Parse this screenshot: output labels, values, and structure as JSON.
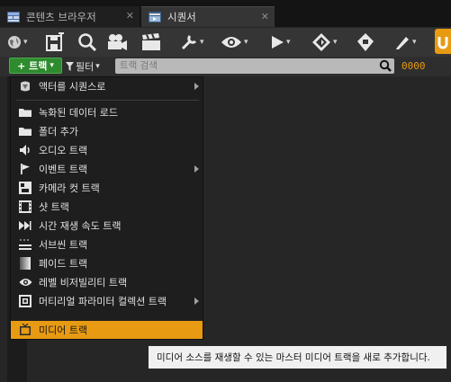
{
  "tabs": [
    {
      "label": "콘텐츠 브라우저",
      "close": "✕"
    },
    {
      "label": "시퀀서",
      "close": "✕"
    }
  ],
  "toolbar": {
    "dropdown_glyph": "▾"
  },
  "filter_bar": {
    "track_button": "+ 트랙",
    "track_dropdown": "▾",
    "filter_button": "필터",
    "filter_dropdown": "▾",
    "search_placeholder": "트랙 검색",
    "timecode": "0000"
  },
  "menu": {
    "items": [
      {
        "label": "액터를 시퀀스로",
        "icon": "actor-icon",
        "submenu": true
      },
      {
        "label": "녹화된 데이터 로드",
        "icon": "folder-icon",
        "submenu": false
      },
      {
        "label": "폴더 추가",
        "icon": "folder-icon",
        "submenu": false
      },
      {
        "label": "오디오 트랙",
        "icon": "speaker-icon",
        "submenu": false
      },
      {
        "label": "이벤트 트랙",
        "icon": "flag-icon",
        "submenu": true
      },
      {
        "label": "카메라 컷 트랙",
        "icon": "camera-cut-icon",
        "submenu": false
      },
      {
        "label": "샷 트랙",
        "icon": "film-icon",
        "submenu": false
      },
      {
        "label": "시간 재생 속도 트랙",
        "icon": "play-rate-icon",
        "submenu": false
      },
      {
        "label": "서브씬 트랙",
        "icon": "subscene-icon",
        "submenu": false
      },
      {
        "label": "페이드 트랙",
        "icon": "fade-icon",
        "submenu": false
      },
      {
        "label": "레벨 비저빌리티 트랙",
        "icon": "eye-icon",
        "submenu": false
      },
      {
        "label": "머티리얼 파라미터 컬렉션 트랙",
        "icon": "material-icon",
        "submenu": true
      },
      {
        "label": "미디어 트랙",
        "icon": "media-tv-icon",
        "submenu": false,
        "selected": true
      }
    ]
  },
  "tooltip": "미디어 소스를 재생할 수 있는 마스터 미디어 트랙을 새로 추가합니다.",
  "colors": {
    "accent": "#e79a12",
    "track_button": "#2e8b2e",
    "background": "#262626"
  }
}
